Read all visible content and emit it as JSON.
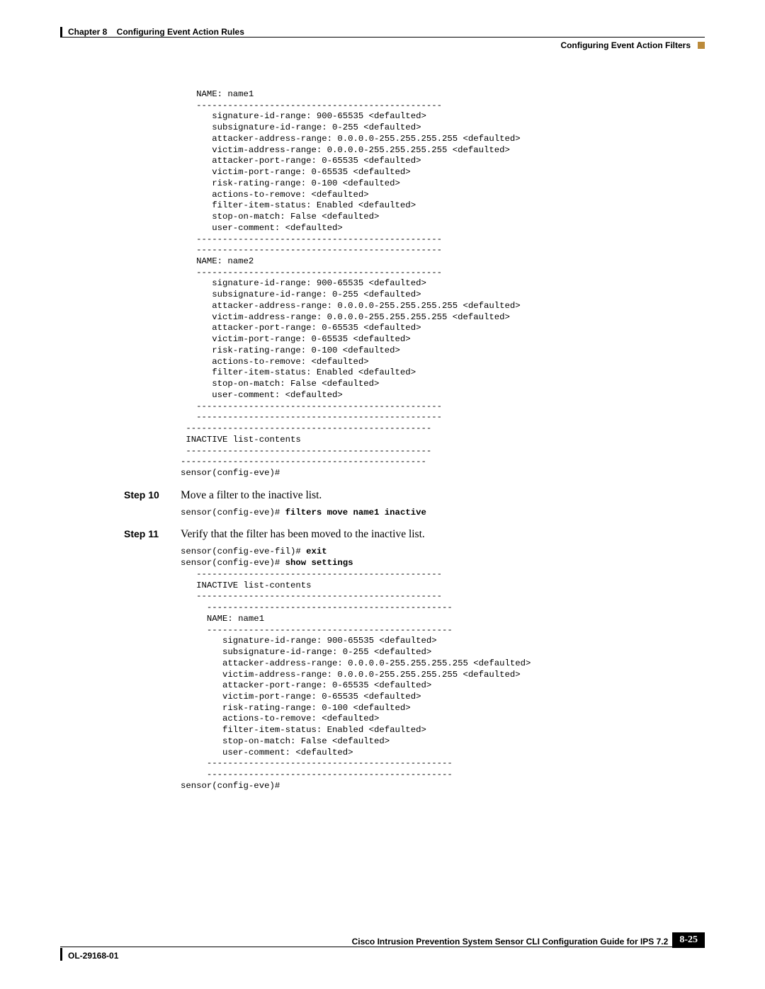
{
  "header": {
    "chapter_left": "Chapter 8    Configuring Event Action Rules",
    "section_right": "Configuring Event Action Filters"
  },
  "codeblock1": "   NAME: name1\n   -----------------------------------------------\n      signature-id-range: 900-65535 <defaulted>\n      subsignature-id-range: 0-255 <defaulted>\n      attacker-address-range: 0.0.0.0-255.255.255.255 <defaulted>\n      victim-address-range: 0.0.0.0-255.255.255.255 <defaulted>\n      attacker-port-range: 0-65535 <defaulted>\n      victim-port-range: 0-65535 <defaulted>\n      risk-rating-range: 0-100 <defaulted>\n      actions-to-remove: <defaulted>\n      filter-item-status: Enabled <defaulted>\n      stop-on-match: False <defaulted>\n      user-comment: <defaulted>\n   -----------------------------------------------\n   -----------------------------------------------\n   NAME: name2\n   -----------------------------------------------\n      signature-id-range: 900-65535 <defaulted>\n      subsignature-id-range: 0-255 <defaulted>\n      attacker-address-range: 0.0.0.0-255.255.255.255 <defaulted>\n      victim-address-range: 0.0.0.0-255.255.255.255 <defaulted>\n      attacker-port-range: 0-65535 <defaulted>\n      victim-port-range: 0-65535 <defaulted>\n      risk-rating-range: 0-100 <defaulted>\n      actions-to-remove: <defaulted>\n      filter-item-status: Enabled <defaulted>\n      stop-on-match: False <defaulted>\n      user-comment: <defaulted>\n   -----------------------------------------------\n   -----------------------------------------------\n -----------------------------------------------\n INACTIVE list-contents\n -----------------------------------------------\n-----------------------------------------------\nsensor(config-eve)#",
  "step10": {
    "label": "Step 10",
    "text": "Move a filter to the inactive list.",
    "code_prefix": "sensor(config-eve)# ",
    "code_bold": "filters move name1 inactive"
  },
  "step11": {
    "label": "Step 11",
    "text": "Verify that the filter has been moved to the inactive list.",
    "code_line1_prefix": "sensor(config-eve-fil)# ",
    "code_line1_bold": "exit",
    "code_line2_prefix": "sensor(config-eve)# ",
    "code_line2_bold": "show settings",
    "code_rest": "   -----------------------------------------------\n   INACTIVE list-contents\n   -----------------------------------------------\n     -----------------------------------------------\n     NAME: name1\n     -----------------------------------------------\n        signature-id-range: 900-65535 <defaulted>\n        subsignature-id-range: 0-255 <defaulted>\n        attacker-address-range: 0.0.0.0-255.255.255.255 <defaulted>\n        victim-address-range: 0.0.0.0-255.255.255.255 <defaulted>\n        attacker-port-range: 0-65535 <defaulted>\n        victim-port-range: 0-65535 <defaulted>\n        risk-rating-range: 0-100 <defaulted>\n        actions-to-remove: <defaulted>\n        filter-item-status: Enabled <defaulted>\n        stop-on-match: False <defaulted>\n        user-comment: <defaulted>\n     -----------------------------------------------\n     -----------------------------------------------\nsensor(config-eve)#"
  },
  "footer": {
    "guide_title": "Cisco Intrusion Prevention System Sensor CLI Configuration Guide for IPS 7.2",
    "page_num": "8-25",
    "ol_num": "OL-29168-01"
  }
}
